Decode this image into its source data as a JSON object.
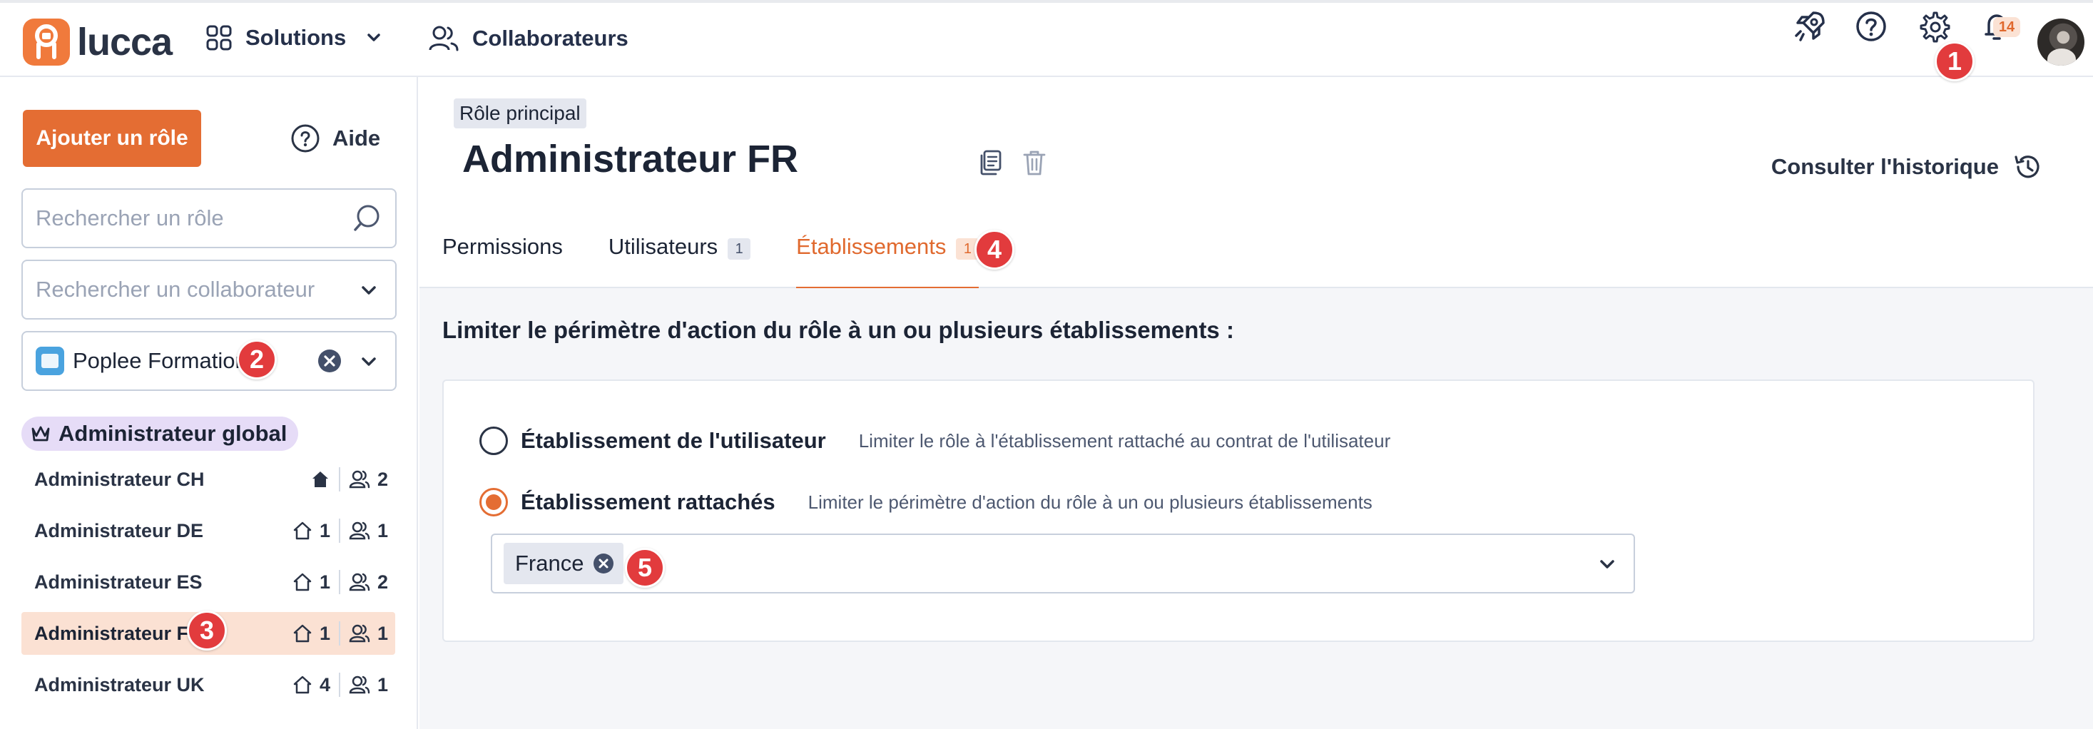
{
  "brand": {
    "name": "lucca",
    "accent": "#e46d33"
  },
  "nav": {
    "solutions_label": "Solutions",
    "collaborateurs_label": "Collaborateurs",
    "notifications_count": "14",
    "icons": [
      "rocket-icon",
      "help-circle-icon",
      "gear-icon",
      "bell-icon"
    ]
  },
  "markers": {
    "m1": "1",
    "m2": "2",
    "m3": "3",
    "m4": "4",
    "m5": "5"
  },
  "sidebar": {
    "add_role_label": "Ajouter un rôle",
    "help_label": "Aide",
    "search_role_placeholder": "Rechercher un rôle",
    "search_collab_placeholder": "Rechercher un collaborateur",
    "company": "Poplee Formation",
    "global_admin_label": "Administrateur global",
    "roles": [
      {
        "name": "Administrateur CH",
        "establishments": "",
        "users": "2",
        "establishments_all": true,
        "active": false
      },
      {
        "name": "Administrateur DE",
        "establishments": "1",
        "users": "1",
        "establishments_all": false,
        "active": false
      },
      {
        "name": "Administrateur ES",
        "establishments": "1",
        "users": "2",
        "establishments_all": false,
        "active": false
      },
      {
        "name": "Administrateur FR",
        "establishments": "1",
        "users": "1",
        "establishments_all": false,
        "active": true
      },
      {
        "name": "Administrateur UK",
        "establishments": "4",
        "users": "1",
        "establishments_all": false,
        "active": false
      }
    ]
  },
  "main": {
    "tag": "Rôle principal",
    "title": "Administrateur FR",
    "history_label": "Consulter l'historique",
    "tabs": [
      {
        "label": "Permissions",
        "count": ""
      },
      {
        "label": "Utilisateurs",
        "count": "1"
      },
      {
        "label": "Établissements",
        "count": "1"
      }
    ],
    "active_tab": "Établissements",
    "section_title": "Limiter le périmètre d'action du rôle à un ou plusieurs établissements :",
    "options": [
      {
        "label": "Établissement de l'utilisateur",
        "description": "Limiter le rôle à l'établissement rattaché au contrat de l'utilisateur",
        "selected": false
      },
      {
        "label": "Établissement rattachés",
        "description": "Limiter le périmètre d'action du rôle à un ou plusieurs établissements",
        "selected": true
      }
    ],
    "selected_establishments": [
      "France"
    ]
  }
}
